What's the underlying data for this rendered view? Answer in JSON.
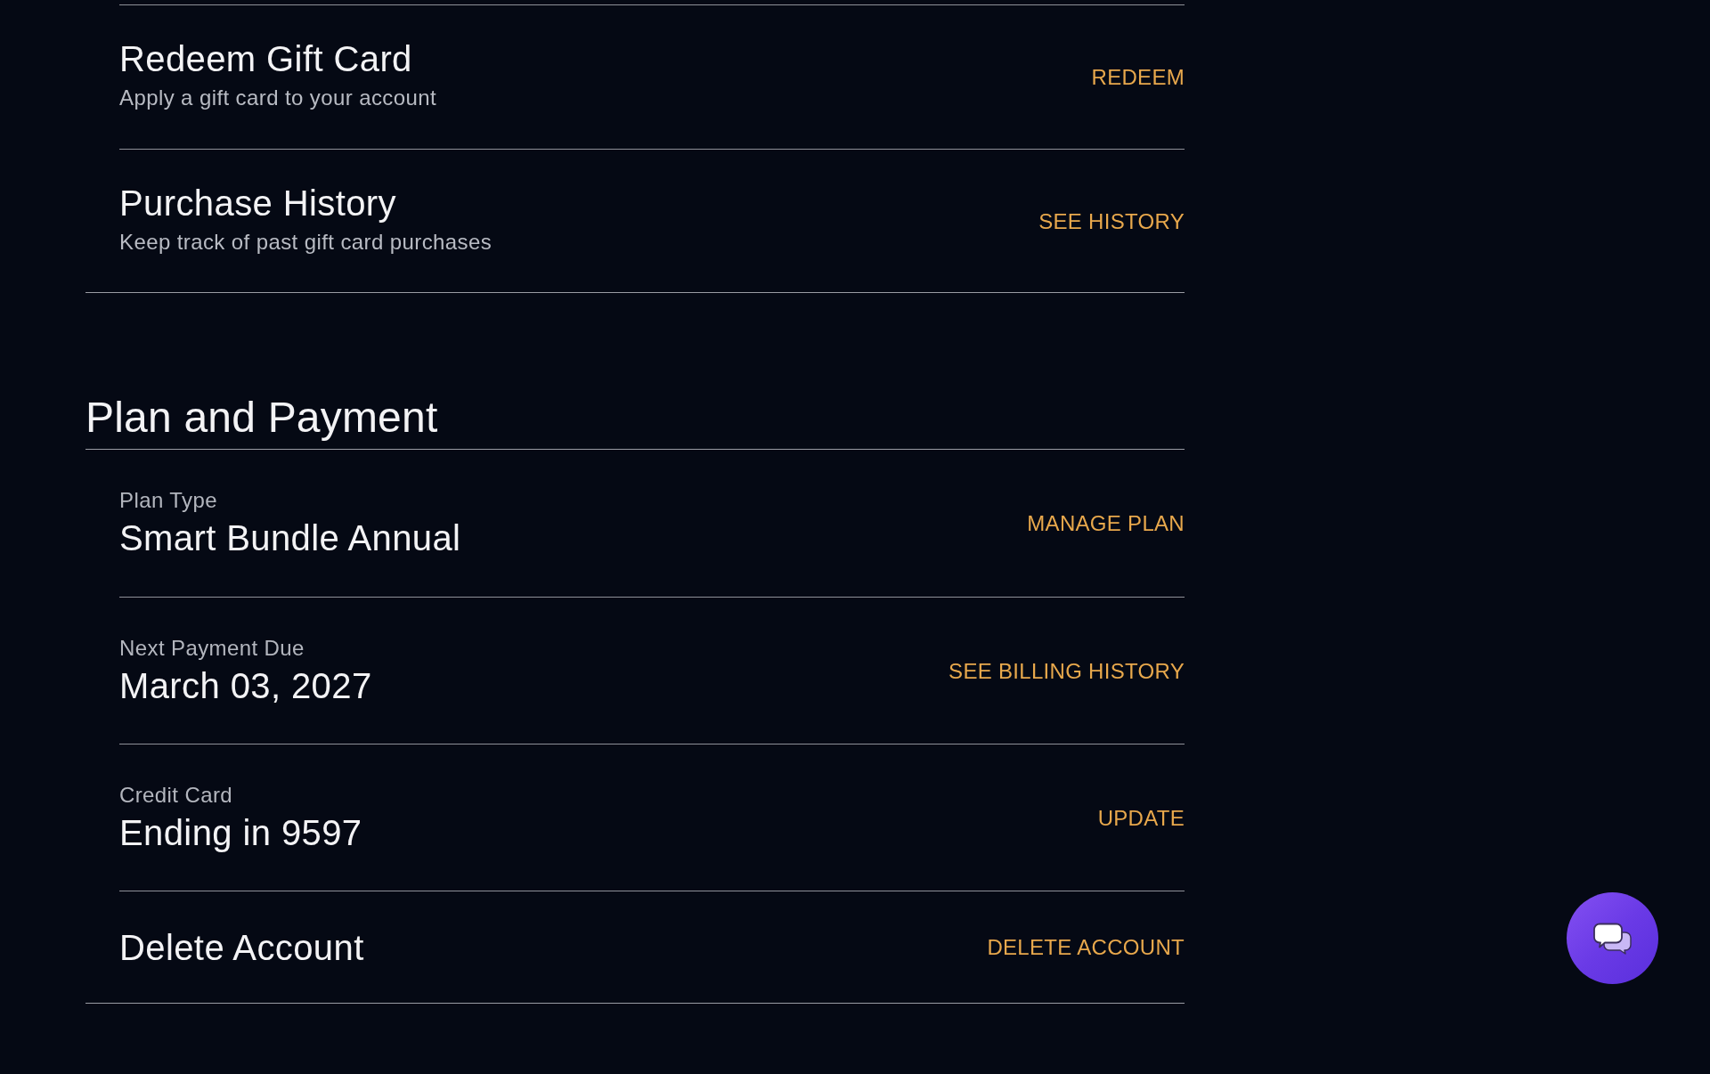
{
  "gift_card_section": {
    "rows": [
      {
        "title": "Redeem Gift Card",
        "description": "Apply a gift card to your account",
        "action": "REDEEM"
      },
      {
        "title": "Purchase History",
        "description": "Keep track of past gift card purchases",
        "action": "SEE HISTORY"
      }
    ]
  },
  "plan_and_payment": {
    "heading": "Plan and Payment",
    "rows": [
      {
        "kind": "labeled",
        "label": "Plan Type",
        "value": "Smart Bundle Annual",
        "action": "MANAGE PLAN"
      },
      {
        "kind": "labeled",
        "label": "Next Payment Due",
        "value": "March 03, 2027",
        "action": "SEE BILLING HISTORY"
      },
      {
        "kind": "labeled",
        "label": "Credit Card",
        "value": "Ending in 9597",
        "action": "UPDATE"
      },
      {
        "kind": "plain",
        "title": "Delete Account",
        "action": "DELETE ACCOUNT"
      }
    ]
  }
}
